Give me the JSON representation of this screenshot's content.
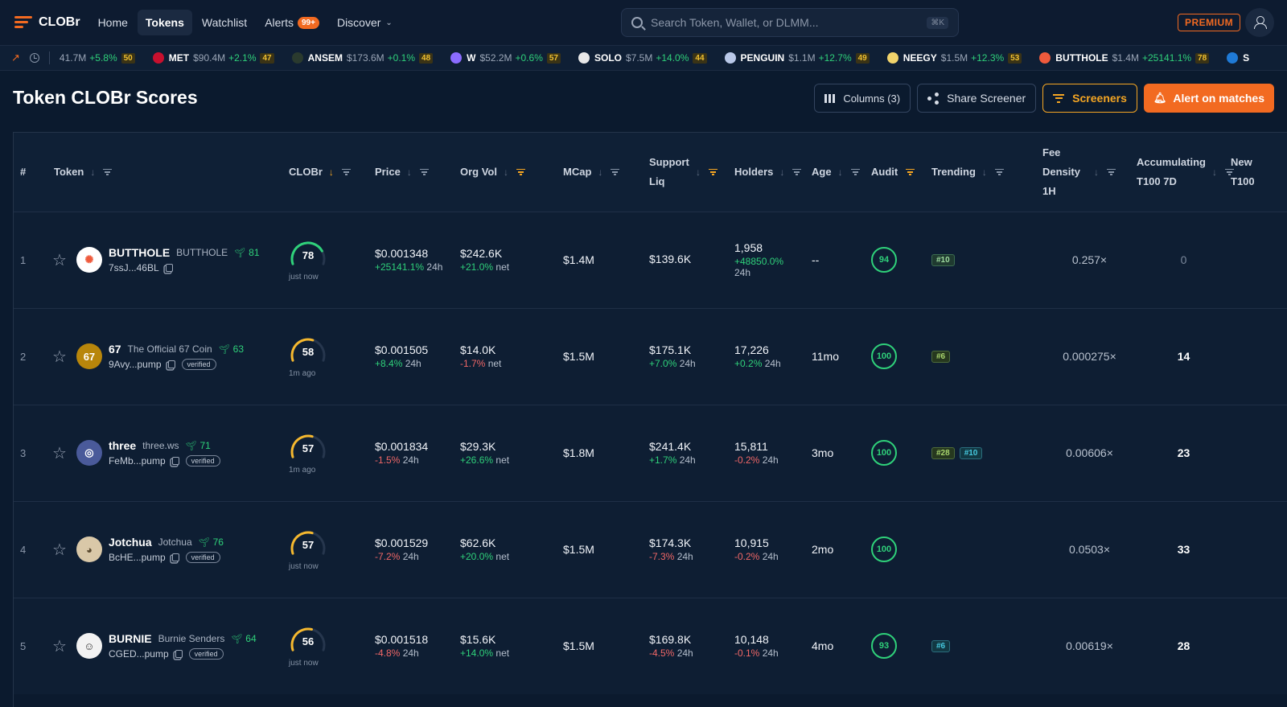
{
  "app": {
    "name": "CLOBr",
    "title": "Token CLOBr Scores"
  },
  "nav": {
    "links": [
      {
        "label": "Home",
        "active": false
      },
      {
        "label": "Tokens",
        "active": true
      },
      {
        "label": "Watchlist",
        "active": false
      },
      {
        "label": "Alerts",
        "active": false,
        "badge": "99+"
      },
      {
        "label": "Discover",
        "active": false,
        "dropdown": true
      }
    ],
    "search_placeholder": "Search Token, Wallet, or DLMM...",
    "search_shortcut": "⌘K",
    "premium_label": "PREMIUM"
  },
  "ticker": {
    "lead": {
      "mc": "41.7M",
      "change": "+5.8%",
      "score": "50"
    },
    "items": [
      {
        "name": "MET",
        "mc": "$90.4M",
        "change": "+2.1%",
        "score": "47",
        "color": "#c8102e"
      },
      {
        "name": "ANSEM",
        "mc": "$173.6M",
        "change": "+0.1%",
        "score": "48",
        "color": "#2a3a2e"
      },
      {
        "name": "W",
        "mc": "$52.2M",
        "change": "+0.6%",
        "score": "57",
        "color": "#8b6cff"
      },
      {
        "name": "SOLO",
        "mc": "$7.5M",
        "change": "+14.0%",
        "score": "44",
        "color": "#e8e8e8"
      },
      {
        "name": "PENGUIN",
        "mc": "$1.1M",
        "change": "+12.7%",
        "score": "49",
        "color": "#b9c8e8"
      },
      {
        "name": "NEEGY",
        "mc": "$1.5M",
        "change": "+12.3%",
        "score": "53",
        "color": "#f1d36b"
      },
      {
        "name": "BUTTHOLE",
        "mc": "$1.4M",
        "change": "+25141.1%",
        "score": "78",
        "color": "#ef5a3c"
      },
      {
        "name": "S",
        "mc": "",
        "change": "",
        "score": "",
        "color": "#1f7ad6"
      }
    ]
  },
  "toolbar": {
    "columns_label": "Columns (3)",
    "share_label": "Share Screener",
    "screeners_label": "Screeners",
    "alert_label": "Alert on matches"
  },
  "table": {
    "headers": {
      "rank": "#",
      "token": "Token",
      "clobr": "CLOBr",
      "price": "Price",
      "orgvol": "Org Vol",
      "mcap": "MCap",
      "support": "Support Liq",
      "holders": "Holders",
      "age": "Age",
      "audit": "Audit",
      "trending": "Trending",
      "fee": "Fee Density 1H",
      "accum": "Accumulating T100 7D",
      "new": "New T100"
    },
    "rows": [
      {
        "rank": "1",
        "symbol": "BUTTHOLE",
        "name": "BUTTHOLE",
        "score": "81",
        "address": "7ssJ...46BL",
        "verified": "",
        "logo_color": "#ef5a3c",
        "logo_bg": "#ffffff",
        "logo_text": "✺",
        "clobr": "78",
        "clobr_fraction": 0.78,
        "clobr_color": "#2fd17a",
        "clobr_time": "just now",
        "price": "$0.001348",
        "price_change": "+25141.1%",
        "price_period": "24h",
        "price_pos": true,
        "orgvol": "$242.6K",
        "orgvol_change": "+21.0%",
        "orgvol_suffix": "net",
        "orgvol_pos": true,
        "mcap": "$1.4M",
        "support": "$139.6K",
        "support_change": "",
        "support_period": "",
        "support_pos": true,
        "holders": "1,958",
        "holders_change": "+48850.0%",
        "holders_period": "24h",
        "holders_pos": true,
        "age": "--",
        "audit": "94",
        "trending": [
          {
            "label": "#10",
            "style": "tb-green"
          }
        ],
        "fee": "0.257×",
        "accum": "0"
      },
      {
        "rank": "2",
        "symbol": "67",
        "name": "The Official 67 Coin",
        "score": "63",
        "address": "9Avy...pump",
        "verified": "verified",
        "logo_color": "#ffffff",
        "logo_bg": "#b8860b",
        "logo_text": "67",
        "clobr": "58",
        "clobr_fraction": 0.58,
        "clobr_color": "#f5b82e",
        "clobr_time": "1m ago",
        "price": "$0.001505",
        "price_change": "+8.4%",
        "price_period": "24h",
        "price_pos": true,
        "orgvol": "$14.0K",
        "orgvol_change": "-1.7%",
        "orgvol_suffix": "net",
        "orgvol_pos": false,
        "mcap": "$1.5M",
        "support": "$175.1K",
        "support_change": "+7.0%",
        "support_period": "24h",
        "support_pos": true,
        "holders": "17,226",
        "holders_change": "+0.2%",
        "holders_period": "24h",
        "holders_pos": true,
        "age": "11mo",
        "audit": "100",
        "trending": [
          {
            "label": "#6",
            "style": "tb-olive"
          }
        ],
        "fee": "0.000275×",
        "accum": "14"
      },
      {
        "rank": "3",
        "symbol": "three",
        "name": "three.ws",
        "score": "71",
        "address": "FeMb...pump",
        "verified": "verified",
        "logo_color": "#ffffff",
        "logo_bg": "#4a5a9a",
        "logo_text": "◎",
        "clobr": "57",
        "clobr_fraction": 0.57,
        "clobr_color": "#f5b82e",
        "clobr_time": "1m ago",
        "price": "$0.001834",
        "price_change": "-1.5%",
        "price_period": "24h",
        "price_pos": false,
        "orgvol": "$29.3K",
        "orgvol_change": "+26.6%",
        "orgvol_suffix": "net",
        "orgvol_pos": true,
        "mcap": "$1.8M",
        "support": "$241.4K",
        "support_change": "+1.7%",
        "support_period": "24h",
        "support_pos": true,
        "holders": "15,811",
        "holders_change": "-0.2%",
        "holders_period": "24h",
        "holders_pos": false,
        "age": "3mo",
        "audit": "100",
        "trending": [
          {
            "label": "#28",
            "style": "tb-olive"
          },
          {
            "label": "#10",
            "style": "tb-teal"
          }
        ],
        "fee": "0.00606×",
        "accum": "23"
      },
      {
        "rank": "4",
        "symbol": "Jotchua",
        "name": "Jotchua",
        "score": "76",
        "address": "BcHE...pump",
        "verified": "verified",
        "logo_color": "#5a4a30",
        "logo_bg": "#d9c8a8",
        "logo_text": "◕",
        "clobr": "57",
        "clobr_fraction": 0.57,
        "clobr_color": "#f5b82e",
        "clobr_time": "just now",
        "price": "$0.001529",
        "price_change": "-7.2%",
        "price_period": "24h",
        "price_pos": false,
        "orgvol": "$62.6K",
        "orgvol_change": "+20.0%",
        "orgvol_suffix": "net",
        "orgvol_pos": true,
        "mcap": "$1.5M",
        "support": "$174.3K",
        "support_change": "-7.3%",
        "support_period": "24h",
        "support_pos": false,
        "holders": "10,915",
        "holders_change": "-0.2%",
        "holders_period": "24h",
        "holders_pos": false,
        "age": "2mo",
        "audit": "100",
        "trending": [],
        "fee": "0.0503×",
        "accum": "33"
      },
      {
        "rank": "5",
        "symbol": "BURNIE",
        "name": "Burnie Senders",
        "score": "64",
        "address": "CGED...pump",
        "verified": "verified",
        "logo_color": "#333333",
        "logo_bg": "#f2f2f2",
        "logo_text": "☺",
        "clobr": "56",
        "clobr_fraction": 0.56,
        "clobr_color": "#f5b82e",
        "clobr_time": "just now",
        "price": "$0.001518",
        "price_change": "-4.8%",
        "price_period": "24h",
        "price_pos": false,
        "orgvol": "$15.6K",
        "orgvol_change": "+14.0%",
        "orgvol_suffix": "net",
        "orgvol_pos": true,
        "mcap": "$1.5M",
        "support": "$169.8K",
        "support_change": "-4.5%",
        "support_period": "24h",
        "support_pos": false,
        "holders": "10,148",
        "holders_change": "-0.1%",
        "holders_period": "24h",
        "holders_pos": false,
        "age": "4mo",
        "audit": "93",
        "trending": [
          {
            "label": "#6",
            "style": "tb-teal"
          }
        ],
        "fee": "0.00619×",
        "accum": "28"
      }
    ]
  }
}
